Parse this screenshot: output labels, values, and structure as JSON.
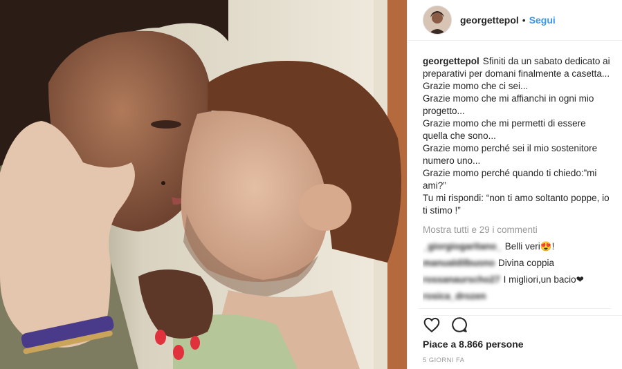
{
  "header": {
    "username": "georgettepol",
    "separator": "•",
    "follow_label": "Segui"
  },
  "caption": {
    "username": "georgettepol",
    "lines": [
      "Sfiniti da un sabato dedicato ai preparativi per domani finalmente a casetta...",
      "Grazie momo che ci sei...",
      "Grazie momo che mi affianchi in ogni mio progetto...",
      "Grazie momo che mi permetti di essere quella che sono...",
      "Grazie momo perché sei il mio sostenitore numero uno...",
      "Grazie momo perché quando ti chiedo:”mi ami?”",
      "Tu mi rispondi: “non ti amo soltanto poppe, io ti stimo !”"
    ]
  },
  "show_all_comments": "Mostra tutti e 29 i commenti",
  "comments": [
    {
      "user": "_giorgiogaritano_",
      "text": "Belli veri😍!"
    },
    {
      "user": "manualdilbuono",
      "text": "Divina coppia"
    },
    {
      "user": "rossanaurscho27",
      "text": "I migliori,un bacio❤"
    },
    {
      "user": "rosica_drozen",
      "text": ""
    }
  ],
  "actions": {
    "like_icon": "heart-icon",
    "comment_icon": "comment-bubble-icon"
  },
  "likes_text": "Piace a 8.866 persone",
  "timestamp": "5 GIORNI FA",
  "colors": {
    "link": "#3897f0",
    "muted": "#999999",
    "text": "#262626"
  }
}
